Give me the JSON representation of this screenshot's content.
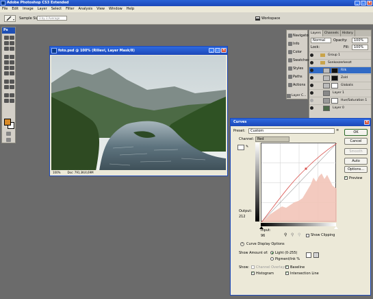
{
  "app": {
    "title": "Adobe Photoshop CS3 Extended",
    "window_buttons": [
      "_",
      "□",
      "×"
    ]
  },
  "menu": [
    "File",
    "Edit",
    "Image",
    "Layer",
    "Select",
    "Filter",
    "Analysis",
    "View",
    "Window",
    "Help"
  ],
  "options_bar": {
    "sample_size_label": "Sample Size:",
    "sample_size_value": "3 by 3 Average",
    "workspace_label": "Workspace"
  },
  "toolbox": {
    "logo": "Ps",
    "foreground_color": "#d88a28",
    "background_color": "#ffffff"
  },
  "document": {
    "title": "foto.psd @ 100% (Rilievi, Layer Mask/8)",
    "zoom": "100%",
    "doc_size": "Doc: 791,3K/4,69M"
  },
  "panels": {
    "items": [
      "Navigator",
      "Info",
      "Color",
      "Swatches",
      "Styles",
      "Paths",
      "Actions"
    ],
    "layer_comps": "Layer C..."
  },
  "layers": {
    "tabs": [
      "Layers",
      "Channels",
      "History"
    ],
    "blend_mode": "Normal",
    "opacity_label": "Opacity:",
    "opacity_value": "100%",
    "lock_label": "Lock:",
    "fill_label": "Fill:",
    "fill_value": "100%",
    "rows": [
      {
        "name": "Group 1"
      },
      {
        "name": "Sonkoszerkeszt"
      },
      {
        "name": "Rilk"
      },
      {
        "name": "Zold"
      },
      {
        "name": "Globalis"
      },
      {
        "name": "Layer 1"
      },
      {
        "name": "Hue/Saturation 1"
      },
      {
        "name": "Layer 0"
      }
    ],
    "selected_index": 2
  },
  "curves": {
    "title": "Curves",
    "preset_label": "Preset:",
    "preset_value": "Custom",
    "channel_label": "Channel:",
    "channel_value": "Red",
    "output_label": "Output:",
    "output_value": "212",
    "input_label": "Input:",
    "input_value": "96",
    "show_clipping": "Show Clipping",
    "display_options": "Curve Display Options",
    "show_amount_label": "Show Amount of:",
    "light_option": "Light (0-255)",
    "pigment_option": "Pigment/Ink %",
    "show_label": "Show:",
    "channel_overlays": "Channel Overlays",
    "baseline": "Baseline",
    "histogram": "Histogram",
    "intersection": "Intersection Line",
    "buttons": {
      "ok": "OK",
      "cancel": "Cancel",
      "smooth": "Smooth",
      "auto": "Auto",
      "options": "Options..."
    },
    "preview": "Preview",
    "curve_color": "#d9534f",
    "histogram_color": "#f2c4b8"
  }
}
